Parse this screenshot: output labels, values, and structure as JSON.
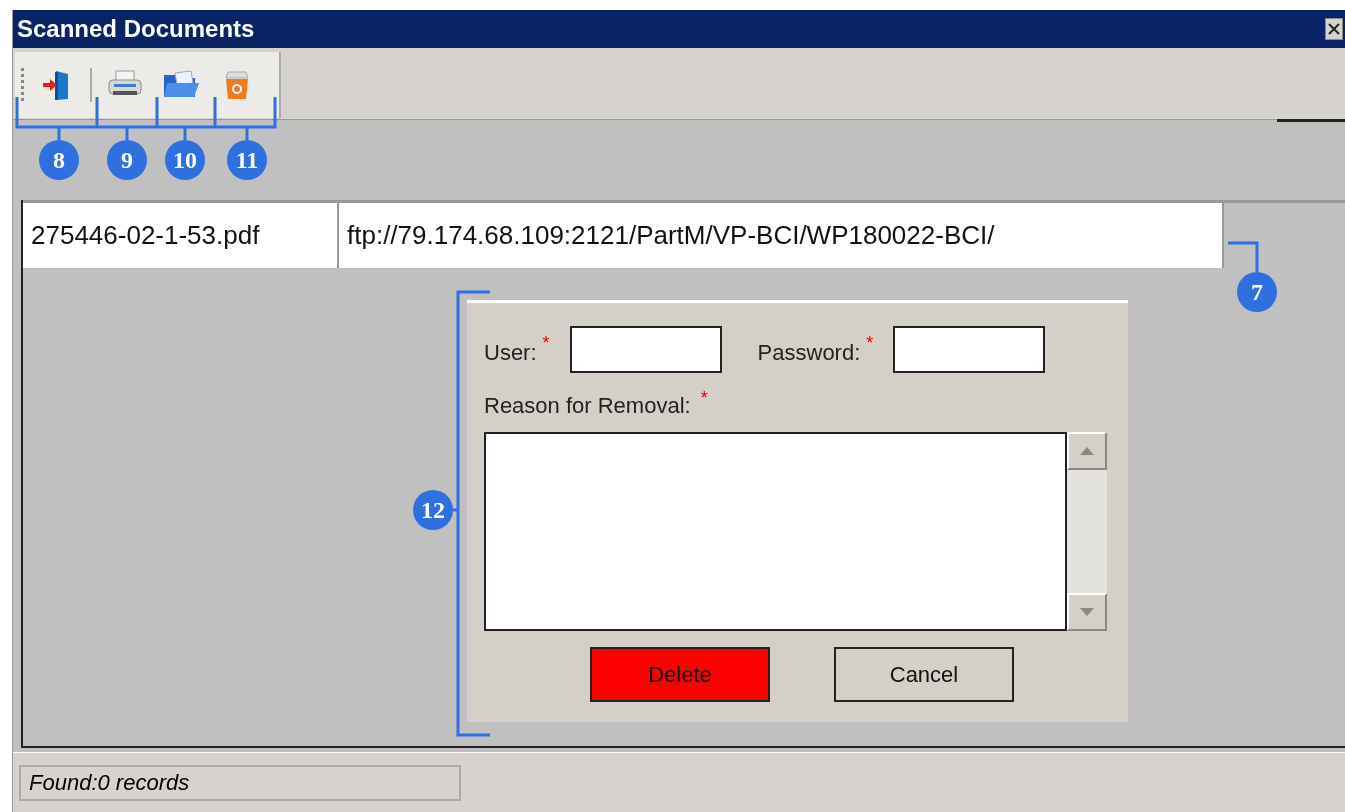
{
  "window": {
    "title": "Scanned Documents"
  },
  "toolbar": [
    {
      "kind": "exit"
    },
    {
      "kind": "print"
    },
    {
      "kind": "open"
    },
    {
      "kind": "delete"
    }
  ],
  "table": {
    "rows": [
      {
        "cells": [
          "275446-02-1-53.pdf",
          "ftp://79.174.68.109:2121/PartM/VP-BCI/WP180022-BCI/"
        ]
      }
    ]
  },
  "dialog": {
    "user": {
      "label": "User:",
      "mark": "*"
    },
    "password": {
      "label": "Password:",
      "mark": "*"
    },
    "reason": {
      "label": "Reason for Removal:",
      "mark": "*"
    },
    "buttons": [
      {
        "label": "Delete",
        "kind": "danger"
      },
      {
        "label": "Cancel",
        "kind": "normal"
      }
    ]
  },
  "status_bar": {
    "text": "Found:0 records"
  },
  "callouts": [
    {
      "number": "8"
    },
    {
      "number": "9"
    },
    {
      "number": "10"
    },
    {
      "number": "11"
    },
    {
      "number": "7"
    },
    {
      "number": "12"
    }
  ]
}
